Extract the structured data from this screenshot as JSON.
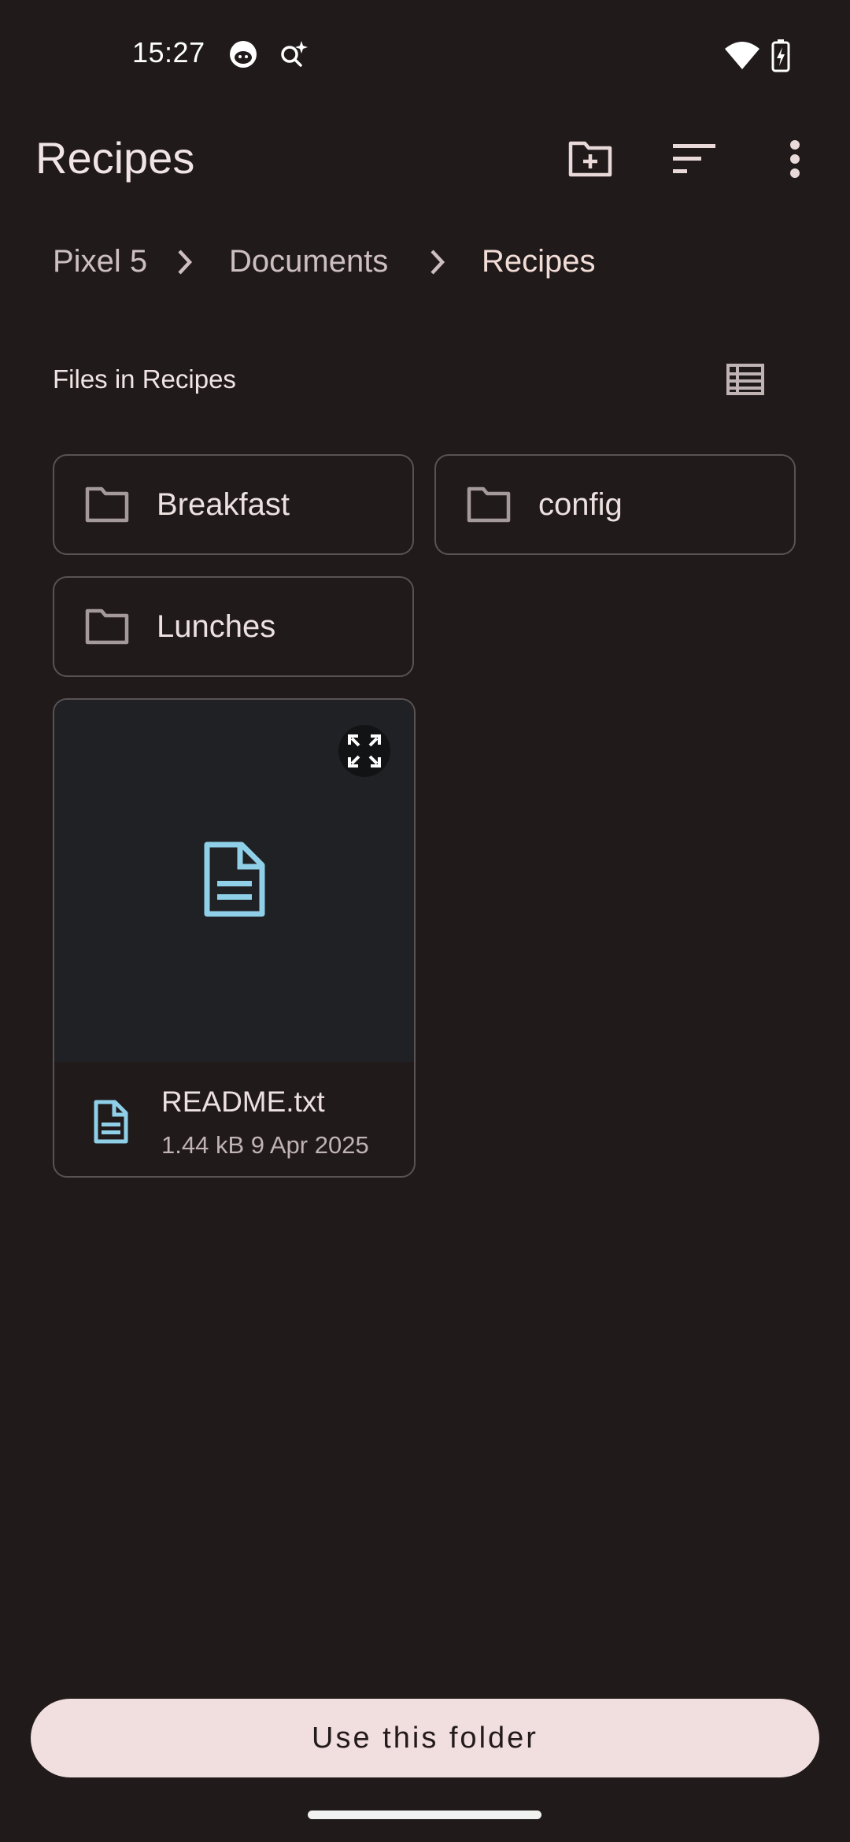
{
  "status_bar": {
    "time": "15:27",
    "icons": [
      "cat-face-icon",
      "search-sparkle-icon",
      "wifi-icon",
      "battery-charging-icon"
    ]
  },
  "app_bar": {
    "title": "Recipes",
    "actions": [
      "new-folder-icon",
      "sort-icon",
      "more-vert-icon"
    ]
  },
  "breadcrumb": {
    "items": [
      "Pixel 5",
      "Documents",
      "Recipes"
    ]
  },
  "section": {
    "title": "Files in Recipes",
    "view_toggle_icon": "list-view-icon"
  },
  "folders": [
    {
      "name": "Breakfast"
    },
    {
      "name": "config"
    },
    {
      "name": "Lunches"
    }
  ],
  "files": [
    {
      "name": "README.txt",
      "meta": "1.44 kB 9 Apr 2025",
      "icon": "text-document-icon"
    }
  ],
  "bottom": {
    "primary_button": "Use this folder"
  },
  "colors": {
    "background": "#201a1b",
    "file_accent": "#8fd0e8",
    "button_bg": "#f1dede"
  }
}
